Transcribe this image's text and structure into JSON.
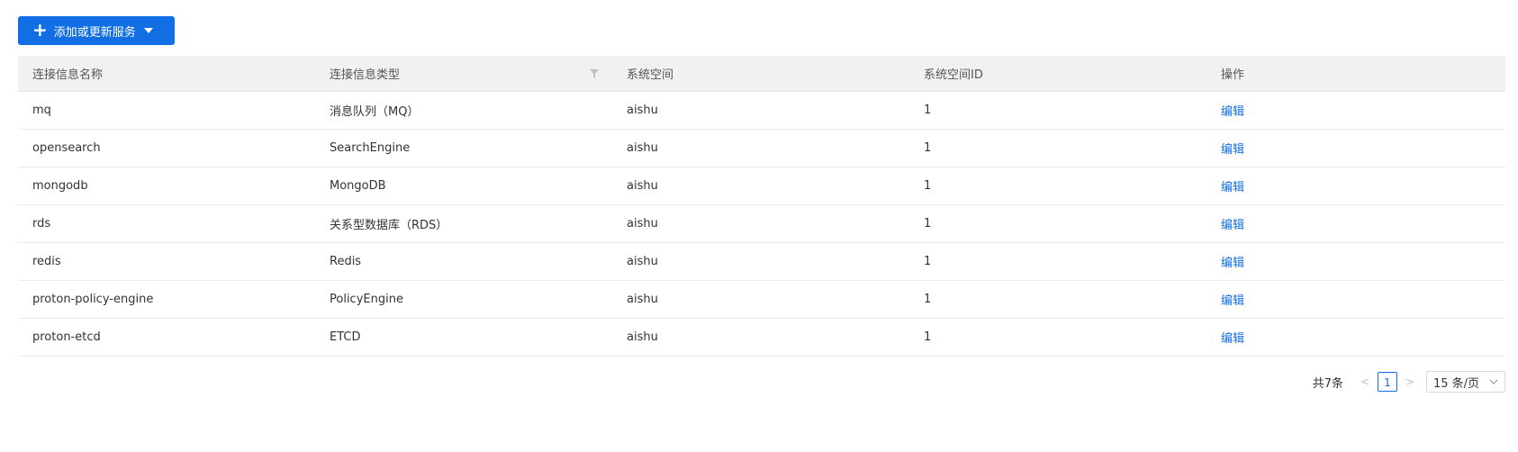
{
  "toolbar": {
    "add_label": "添加或更新服务",
    "plus_icon": "plus-icon",
    "dropdown_icon": "caret-down-icon",
    "accent": "#126ee3"
  },
  "table": {
    "columns": [
      "连接信息名称",
      "连接信息类型",
      "系统空间",
      "系统空间ID",
      "操作"
    ],
    "rows": [
      {
        "name": "mq",
        "type": "消息队列（MQ）",
        "space": "aishu",
        "space_id": "1",
        "action": "编辑"
      },
      {
        "name": "opensearch",
        "type": "SearchEngine",
        "space": "aishu",
        "space_id": "1",
        "action": "编辑"
      },
      {
        "name": "mongodb",
        "type": "MongoDB",
        "space": "aishu",
        "space_id": "1",
        "action": "编辑"
      },
      {
        "name": "rds",
        "type": "关系型数据库（RDS）",
        "space": "aishu",
        "space_id": "1",
        "action": "编辑"
      },
      {
        "name": "redis",
        "type": "Redis",
        "space": "aishu",
        "space_id": "1",
        "action": "编辑"
      },
      {
        "name": "proton-policy-engine",
        "type": "PolicyEngine",
        "space": "aishu",
        "space_id": "1",
        "action": "编辑"
      },
      {
        "name": "proton-etcd",
        "type": "ETCD",
        "space": "aishu",
        "space_id": "1",
        "action": "编辑"
      }
    ]
  },
  "pagination": {
    "total_text": "共7条",
    "prev": "<",
    "current": "1",
    "next": ">",
    "page_size": "15 条/页"
  }
}
